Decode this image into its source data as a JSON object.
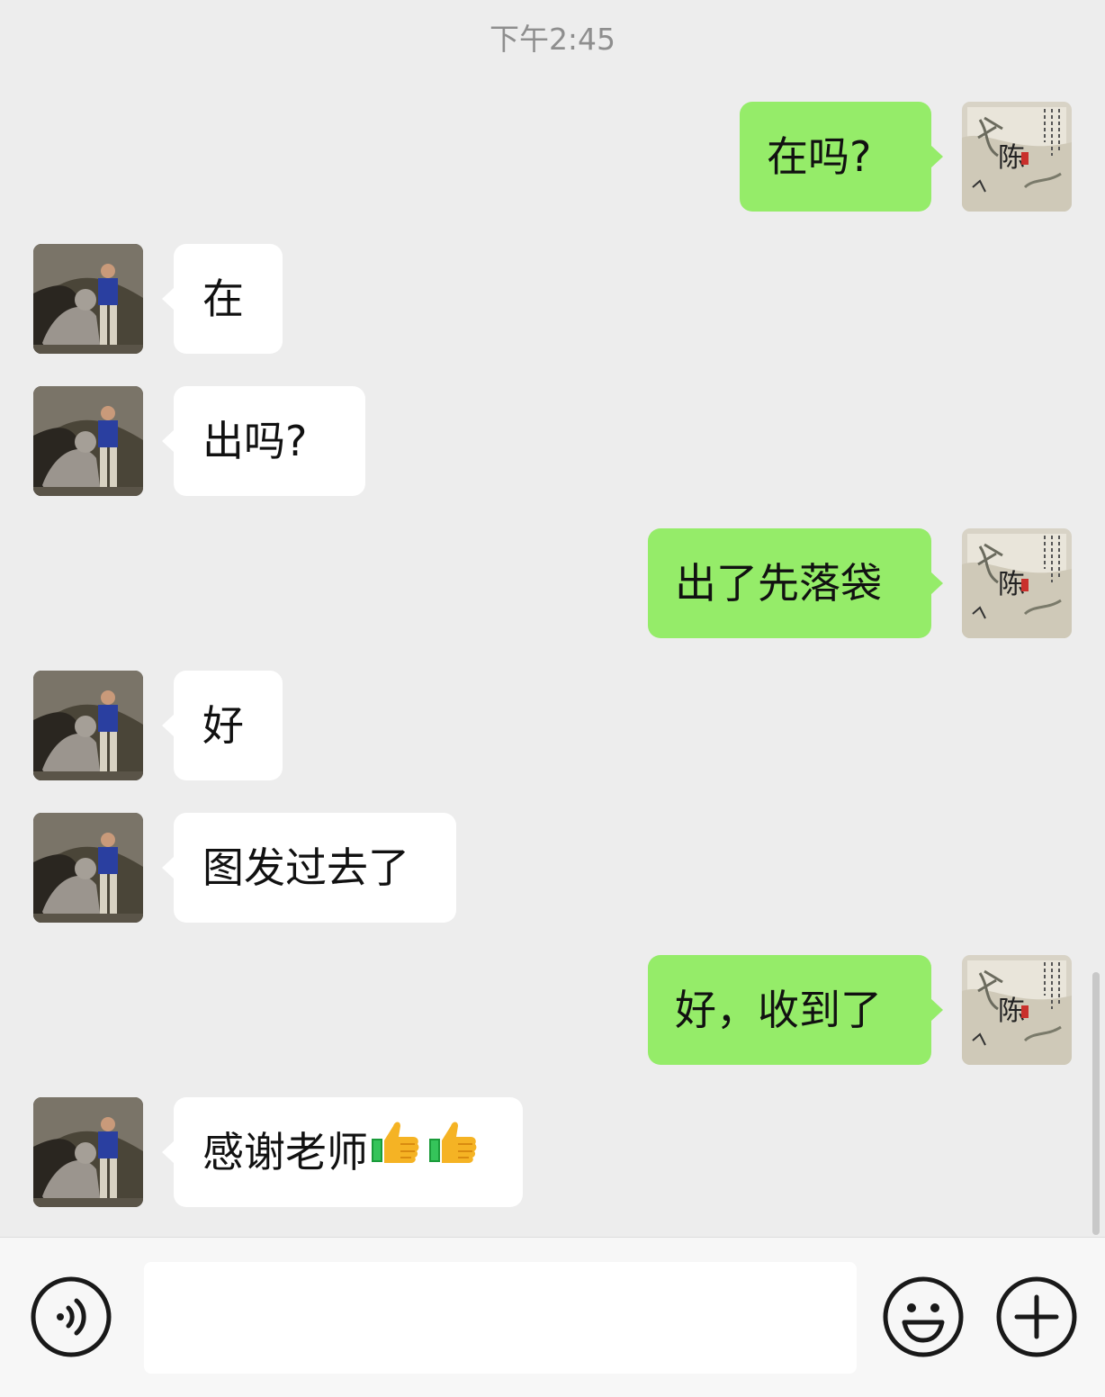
{
  "chat": {
    "timestamp": "下午2:45",
    "messages": [
      {
        "side": "out",
        "text": "在吗?"
      },
      {
        "side": "in",
        "text": "在"
      },
      {
        "side": "in",
        "text": "出吗?"
      },
      {
        "side": "out",
        "text": "出了先落袋"
      },
      {
        "side": "in",
        "text": "好"
      },
      {
        "side": "in",
        "text": "图发过去了"
      },
      {
        "side": "out",
        "text": "好，收到了"
      },
      {
        "side": "in",
        "text": "感谢老师",
        "emoji": [
          "thumbs-up-icon",
          "thumbs-up-icon"
        ]
      }
    ],
    "self_avatar_text": "陈"
  },
  "input_bar": {
    "voice_icon": "voice-icon",
    "emoji_icon": "smiley-icon",
    "more_icon": "plus-icon",
    "input_value": ""
  },
  "colors": {
    "background": "#ededed",
    "outgoing_bubble": "#95ec69",
    "incoming_bubble": "#ffffff",
    "timestamp_text": "#8e8e8e"
  }
}
